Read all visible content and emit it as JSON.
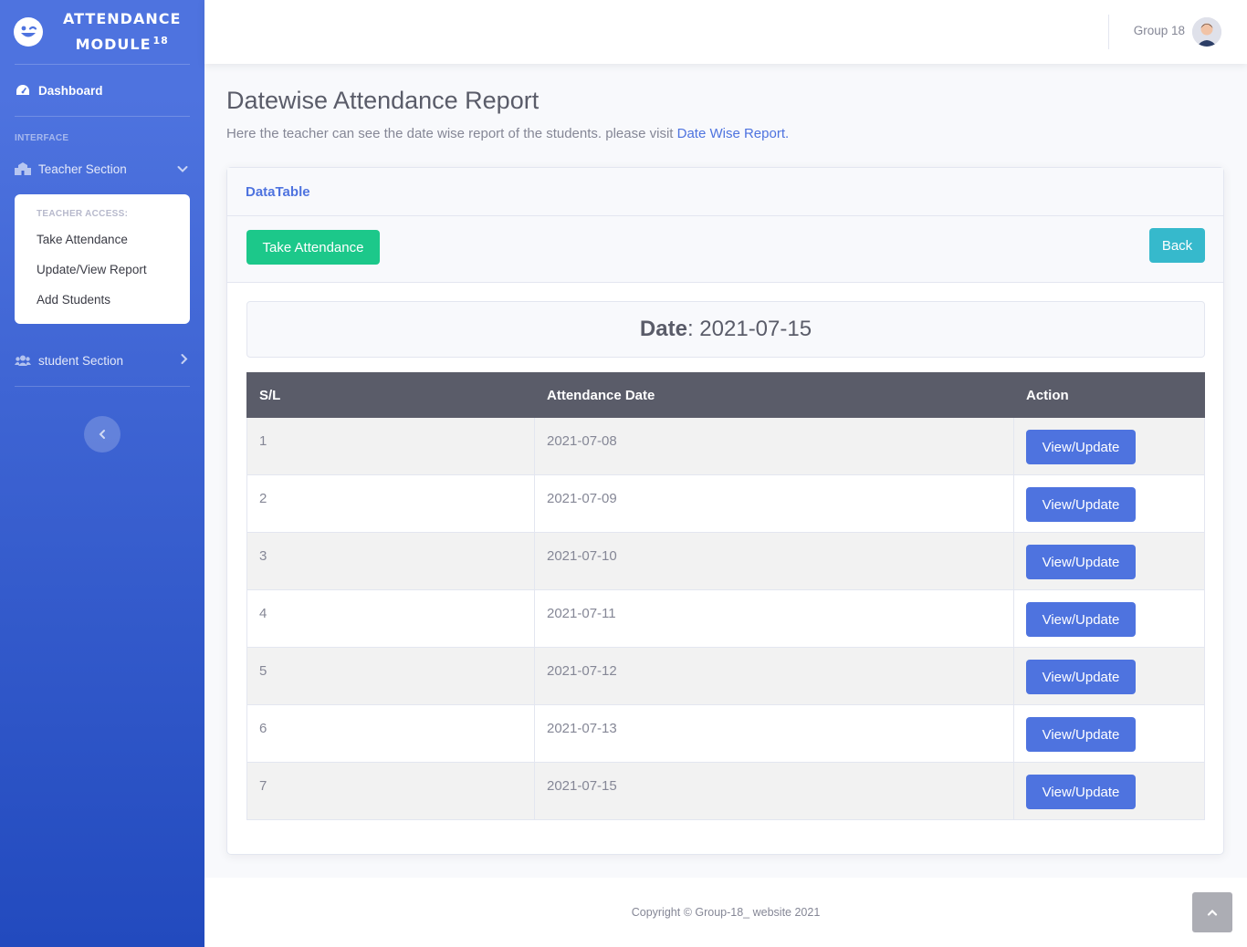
{
  "sidebar": {
    "brand_line1": "ATTENDANCE",
    "brand_line2": "MODULE",
    "brand_sup": "18",
    "dashboard_label": "Dashboard",
    "heading_interface": "INTERFACE",
    "teacher_section_label": "Teacher Section",
    "teacher_access_header": "TEACHER ACCESS:",
    "teacher_items": [
      "Take Attendance",
      "Update/View Report",
      "Add Students"
    ],
    "student_section_label": "student Section"
  },
  "topbar": {
    "user_name": "Group 18"
  },
  "page": {
    "title": "Datewise Attendance Report",
    "description": "Here the teacher can see the date wise report of the students. please visit ",
    "description_link": "Date Wise Report",
    "description_end": "."
  },
  "card": {
    "header": "DataTable",
    "take_attendance_label": "Take Attendance",
    "back_label": "Back",
    "date_label": "Date",
    "date_value": "2021-07-15"
  },
  "table": {
    "columns": [
      "S/L",
      "Attendance Date",
      "Action"
    ],
    "action_label": "View/Update",
    "rows": [
      {
        "sl": "1",
        "date": "2021-07-08"
      },
      {
        "sl": "2",
        "date": "2021-07-09"
      },
      {
        "sl": "3",
        "date": "2021-07-10"
      },
      {
        "sl": "4",
        "date": "2021-07-11"
      },
      {
        "sl": "5",
        "date": "2021-07-12"
      },
      {
        "sl": "6",
        "date": "2021-07-13"
      },
      {
        "sl": "7",
        "date": "2021-07-15"
      }
    ]
  },
  "footer": {
    "copyright": "Copyright © Group-18_ website 2021"
  },
  "colors": {
    "primary": "#4e73df",
    "success": "#1cc88a",
    "info": "#36b9cc",
    "table_header": "#5a5c69"
  }
}
